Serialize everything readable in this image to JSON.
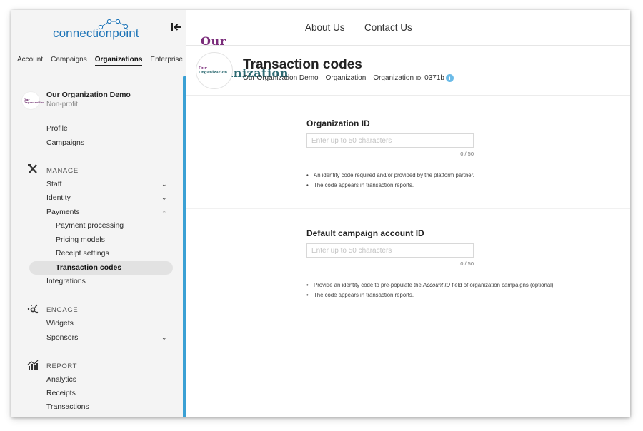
{
  "sidebar": {
    "logo": "connectionpoint",
    "topnav": [
      "Account",
      "Campaigns",
      "Organizations",
      "Enterprise"
    ],
    "active_topnav": "Organizations",
    "org": {
      "avatar_text": "Our Organization",
      "name": "Our Organization Demo",
      "type": "Non-profit"
    },
    "links": {
      "profile": "Profile",
      "campaigns": "Campaigns"
    },
    "manage": {
      "title": "MANAGE",
      "staff": "Staff",
      "identity": "Identity",
      "payments": "Payments",
      "payment_processing": "Payment processing",
      "pricing_models": "Pricing models",
      "receipt_settings": "Receipt settings",
      "transaction_codes": "Transaction codes",
      "integrations": "Integrations"
    },
    "engage": {
      "title": "ENGAGE",
      "widgets": "Widgets",
      "sponsors": "Sponsors"
    },
    "report": {
      "title": "REPORT",
      "analytics": "Analytics",
      "receipts": "Receipts",
      "transactions": "Transactions"
    }
  },
  "header": {
    "brand_line1": "Our",
    "brand_line2": "Organization",
    "nav": [
      "About Us",
      "Contact Us"
    ]
  },
  "page": {
    "avatar_line1": "Our",
    "avatar_line2": "Organization",
    "title": "Transaction codes",
    "breadcrumb": {
      "org": "Our Organization Demo",
      "section": "Organization",
      "id_label": "Organization",
      "id_suffix": "ID:",
      "id_value": "0371b"
    }
  },
  "form": {
    "org_id": {
      "label": "Organization ID",
      "placeholder": "Enter up to 50 characters",
      "value": "",
      "counter": "0 / 50",
      "help": [
        "An identity code required and/or provided by the platform partner.",
        "The code appears in transaction reports."
      ]
    },
    "campaign_id": {
      "label": "Default campaign account ID",
      "placeholder": "Enter up to 50 characters",
      "value": "",
      "counter": "0 / 50",
      "help1_pre": "Provide an identity code to pre-populate the ",
      "help1_em": "Account ID",
      "help1_post": " field of organization campaigns (optional).",
      "help2": "The code appears in transaction reports."
    }
  },
  "colors": {
    "accent": "#3aa0d4",
    "brand_purple": "#7b2d7b",
    "brand_teal": "#2d6a72",
    "logo_blue": "#1d74b7"
  }
}
